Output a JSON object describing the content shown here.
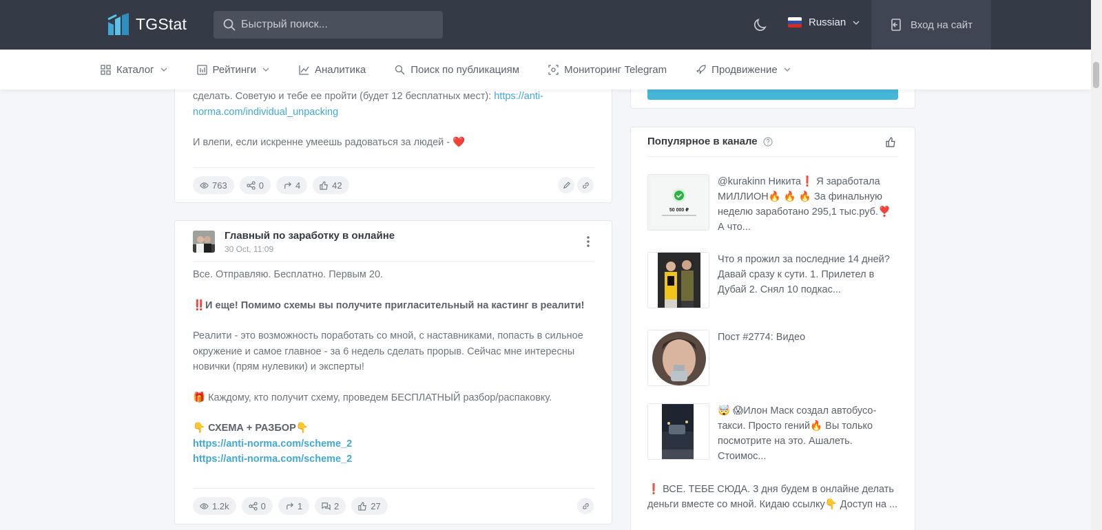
{
  "header": {
    "logo_text": "TGStat",
    "search_placeholder": "Быстрый поиск...",
    "language": "Russian",
    "login_label": "Вход на сайт"
  },
  "nav": {
    "catalog": "Каталог",
    "ratings": "Рейтинги",
    "analytics": "Аналитика",
    "search_posts": "Поиск по публикациям",
    "monitoring": "Мониторинг Telegram",
    "promotion": "Продвижение"
  },
  "post1": {
    "line1": "сделать. Советую и тебе ее пройти (будет 12 бесплатных мест): ",
    "link1": "https://anti-",
    "link2": "norma.com/individual_unpacking",
    "line2": "И влепи, если искренне умеешь радоваться за людей - ",
    "heart": "❤️",
    "stats": {
      "views": "763",
      "shares": "0",
      "forwards": "4",
      "likes": "42"
    }
  },
  "post2": {
    "channel_name": "Главный по заработку в онлайне",
    "date": "30 Oct, 11:09",
    "p1": "Все. Отправляю. Бесплатно. Первым 20.",
    "p2": "‼️И еще! Помимо схемы вы получите пригласительный на кастинг в реалити!",
    "p3a": "Реалити - это возможность поработать со мной, с наставниками, попасть в сильное",
    "p3b": "окружение и самое главное - за 6 недель сделать прорыв. Сейчас мне интересны",
    "p3c": "новички (прям нулевики) и эксперты!",
    "p4": "🎁 Каждому, кто получит схему, проведем БЕСПЛАТНЫЙ разбор/распаковку.",
    "p5": "👇 СХЕМА + РАЗБОР👇",
    "link_a": "https://anti-norma.com/scheme_2",
    "link_b": "https://anti-norma.com/scheme_2",
    "stats": {
      "views": "1.2k",
      "shares": "0",
      "forwards": "1",
      "comments": "2",
      "likes": "27"
    }
  },
  "sidebar": {
    "popular_title": "Популярное в канале",
    "items": [
      {
        "text": "@kurakinn Никита❗️ Я заработала МИЛЛИОН🔥 🔥 🔥 За финальную неделю заработано 295,1 тыс.руб.❣️ А что...",
        "thumb_caption": "50 000 ₽"
      },
      {
        "text": "Что я прожил за последние 14 дней? Давай сразу к сути. 1. Прилетел в Дубай 2. Снял 10 подкас..."
      },
      {
        "text": "Пост #2774: Видео"
      },
      {
        "text": "🤯 😱Илон Маск создал автобусо-такси. Просто гений🔥 Вы только посмотрите на это. Ашалеть. Стоимос..."
      },
      {
        "text": "❗️ ВСЕ. ТЕБЕ СЮДА. 3 дня будем в онлайне делать деньги вместе со мной. Кидаю ссылку👇 Доступ на ..."
      }
    ]
  },
  "colors": {
    "topbar": "#343a46",
    "accent": "#3fa9d6",
    "teal_button": "#44b6d8"
  }
}
